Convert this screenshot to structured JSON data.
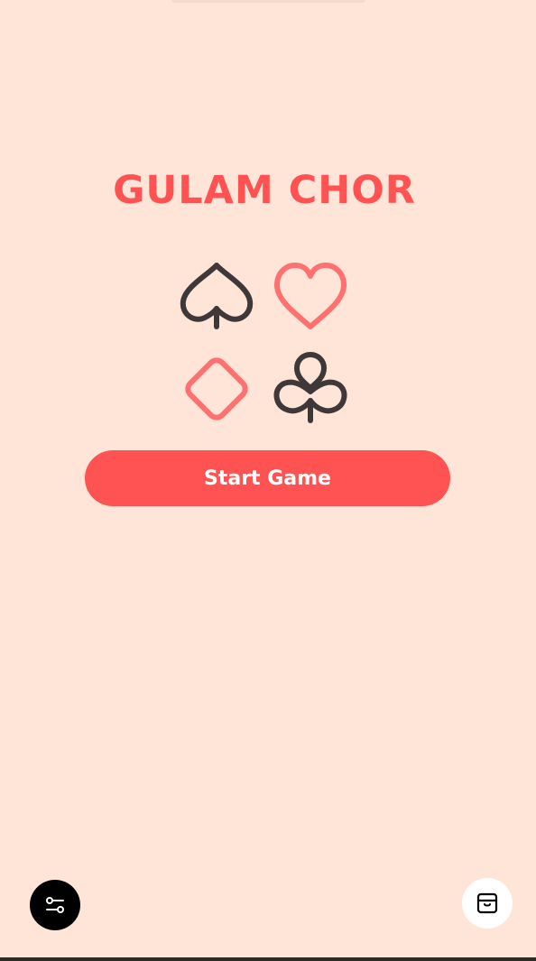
{
  "app": {
    "title": "GULAM CHOR",
    "start_button_label": "Start Game"
  },
  "suits": [
    {
      "name": "spade",
      "color": "#3E3838"
    },
    {
      "name": "heart",
      "color": "#FF7070"
    },
    {
      "name": "diamond",
      "color": "#FF7070"
    },
    {
      "name": "club",
      "color": "#3E3838"
    }
  ],
  "colors": {
    "background": "#FFE5D8",
    "accent": "#FF5252",
    "dark": "#3E3838"
  },
  "controls": {
    "left_icon": "settings-sliders-icon",
    "right_icon": "archive-box-icon"
  }
}
